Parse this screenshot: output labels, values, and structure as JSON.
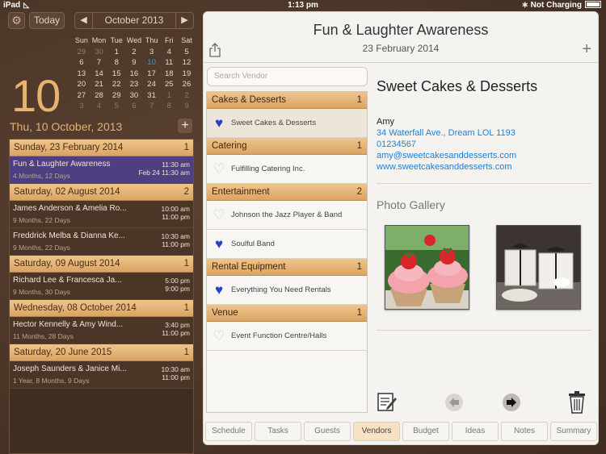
{
  "status": {
    "device": "iPad",
    "time": "1:13 pm",
    "charging": "Not Charging"
  },
  "calendar": {
    "today_label": "Today",
    "month_label": "October 2013",
    "weekdays": [
      "Sun",
      "Mon",
      "Tue",
      "Wed",
      "Thu",
      "Fri",
      "Sat"
    ],
    "weeks": [
      [
        "29",
        "30",
        "1",
        "2",
        "3",
        "4",
        "5"
      ],
      [
        "6",
        "7",
        "8",
        "9",
        "10",
        "11",
        "12"
      ],
      [
        "13",
        "14",
        "15",
        "16",
        "17",
        "18",
        "19"
      ],
      [
        "20",
        "21",
        "22",
        "23",
        "24",
        "25",
        "26"
      ],
      [
        "27",
        "28",
        "29",
        "30",
        "31",
        "1",
        "2"
      ],
      [
        "3",
        "4",
        "5",
        "6",
        "7",
        "8",
        "9"
      ]
    ],
    "big_day": "10",
    "selected_date": "Thu, 10 October, 2013"
  },
  "events": [
    {
      "header": "Sunday, 23 February 2014",
      "count": "1",
      "items": [
        {
          "title": "Fun & Laughter Awareness",
          "sub": "4 Months, 12 Days",
          "t1": "11:30 am",
          "t2": "Feb 24  11:30 am",
          "selected": true
        }
      ]
    },
    {
      "header": "Saturday, 02 August 2014",
      "count": "2",
      "items": [
        {
          "title": "James Anderson & Amelia Ro...",
          "sub": "9 Months, 22 Days",
          "t1": "10:00 am",
          "t2": "11:00 pm"
        },
        {
          "title": "Freddrick Melba & Dianna Ke...",
          "sub": "9 Months, 22 Days",
          "t1": "10:30 am",
          "t2": "11:00 pm"
        }
      ]
    },
    {
      "header": "Saturday, 09 August 2014",
      "count": "1",
      "items": [
        {
          "title": "Richard Lee & Francesca Ja...",
          "sub": "9 Months, 30 Days",
          "t1": "5:00 pm",
          "t2": "9:00 pm"
        }
      ]
    },
    {
      "header": "Wednesday, 08 October 2014",
      "count": "1",
      "items": [
        {
          "title": "Hector Kennelly & Amy Wind...",
          "sub": "11 Months, 28 Days",
          "t1": "3:40 pm",
          "t2": "11:00 pm"
        }
      ]
    },
    {
      "header": "Saturday, 20 June 2015",
      "count": "1",
      "items": [
        {
          "title": "Joseph Saunders & Janice Mi...",
          "sub": "1 Year, 8 Months, 9 Days",
          "t1": "10:30 am",
          "t2": "11:00 pm"
        }
      ]
    }
  ],
  "main": {
    "title": "Fun & Laughter Awareness",
    "date": "23 February 2014",
    "search_placeholder": "Search Vendor"
  },
  "vendors": [
    {
      "category": "Cakes & Desserts",
      "count": "1",
      "items": [
        {
          "name": "Sweet Cakes & Desserts",
          "fav": true,
          "selected": true
        }
      ]
    },
    {
      "category": "Catering",
      "count": "1",
      "items": [
        {
          "name": "Fulfilling Catering Inc.",
          "fav": false
        }
      ]
    },
    {
      "category": "Entertainment",
      "count": "2",
      "items": [
        {
          "name": "Johnson the Jazz Player & Band",
          "fav": false
        },
        {
          "name": "Soulful Band",
          "fav": true
        }
      ]
    },
    {
      "category": "Rental Equipment",
      "count": "1",
      "items": [
        {
          "name": "Everything You Need Rentals",
          "fav": true
        }
      ]
    },
    {
      "category": "Venue",
      "count": "1",
      "items": [
        {
          "name": "Event Function Centre/Halls",
          "fav": false
        }
      ]
    }
  ],
  "detail": {
    "name": "Sweet Cakes & Desserts",
    "contact": "Amy",
    "address": "34 Waterfall Ave., Dream LOL 1193",
    "phone": "01234567",
    "email": "amy@sweetcakesanddesserts.com",
    "website": "www.sweetcakesanddesserts.com",
    "gallery_title": "Photo Gallery"
  },
  "tabs": [
    "Schedule",
    "Tasks",
    "Guests",
    "Vendors",
    "Budget",
    "Ideas",
    "Notes",
    "Summary"
  ],
  "active_tab": "Vendors"
}
